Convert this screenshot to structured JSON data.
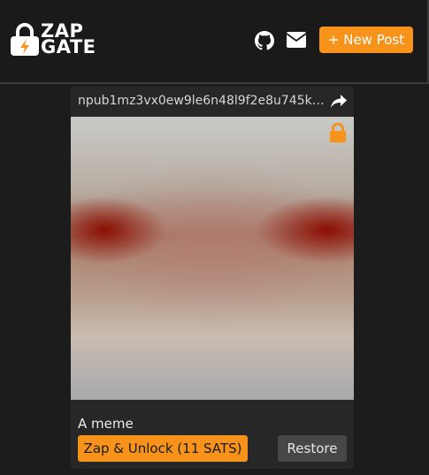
{
  "header": {
    "logo_line1": "ZAP",
    "logo_line2": "GATE",
    "new_post_label": "+ New Post",
    "icons": [
      "github-icon",
      "mail-icon"
    ]
  },
  "post": {
    "author_npub": "npub1mz3vx0ew9le6n48l9f2e8u745k0...",
    "caption": "A meme",
    "zap_label": "Zap & Unlock (11 SATS)",
    "restore_label": "Restore",
    "icons": [
      "share-icon",
      "padlock-icon"
    ]
  },
  "colors": {
    "accent": "#f7931a",
    "background": "#1c1c1c",
    "card": "#272727"
  }
}
